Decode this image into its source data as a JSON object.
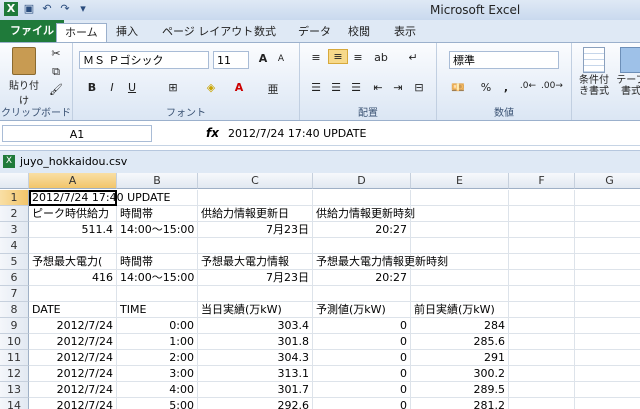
{
  "window": {
    "title": "Microsoft Excel"
  },
  "ribbon_tabs": [
    "ファイル",
    "ホーム",
    "挿入",
    "ページ レイアウト",
    "数式",
    "データ",
    "校閲",
    "表示"
  ],
  "ribbon": {
    "paste_label": "貼り付け",
    "clipboard_label": "クリップボード",
    "font_name": "ＭＳ Ｐゴシック",
    "font_size": "11",
    "font_group_label": "フォント",
    "align_group_label": "配置",
    "number_format": "標準",
    "number_group_label": "数値",
    "cond_format_label": "条件付き書式",
    "table_label": "テーブ書式"
  },
  "formula_bar": {
    "name_box": "A1",
    "fx": "fx",
    "formula": "2012/7/24 17:40 UPDATE"
  },
  "workbook": {
    "name": "juyo_hokkaidou.csv"
  },
  "columns": [
    "A",
    "B",
    "C",
    "D",
    "E",
    "F",
    "G"
  ],
  "rows": [
    {
      "n": "1",
      "cells": [
        "2012/7/24 17:40 UPDATE",
        "",
        "",
        "",
        "",
        "",
        ""
      ]
    },
    {
      "n": "2",
      "cells": [
        "ピーク時供給力",
        "時間帯",
        "供給力情報更新日",
        "供給力情報更新時刻",
        "",
        "",
        ""
      ]
    },
    {
      "n": "3",
      "cells": [
        "511.4",
        "14:00～15:00",
        "7月23日",
        "20:27",
        "",
        "",
        ""
      ]
    },
    {
      "n": "4",
      "cells": [
        "",
        "",
        "",
        "",
        "",
        "",
        ""
      ]
    },
    {
      "n": "5",
      "cells": [
        "予想最大電力(",
        "時間帯",
        "予想最大電力情報",
        "予想最大電力情報更新時刻",
        "",
        "",
        ""
      ]
    },
    {
      "n": "6",
      "cells": [
        "416",
        "14:00～15:00",
        "7月23日",
        "20:27",
        "",
        "",
        ""
      ]
    },
    {
      "n": "7",
      "cells": [
        "",
        "",
        "",
        "",
        "",
        "",
        ""
      ]
    },
    {
      "n": "8",
      "cells": [
        "DATE",
        "TIME",
        "当日実績(万kW)",
        "予測値(万kW)",
        "前日実績(万kW)",
        "",
        ""
      ]
    },
    {
      "n": "9",
      "cells": [
        "2012/7/24",
        "0:00",
        "303.4",
        "0",
        "284",
        "",
        ""
      ]
    },
    {
      "n": "10",
      "cells": [
        "2012/7/24",
        "1:00",
        "301.8",
        "0",
        "285.6",
        "",
        ""
      ]
    },
    {
      "n": "11",
      "cells": [
        "2012/7/24",
        "2:00",
        "304.3",
        "0",
        "291",
        "",
        ""
      ]
    },
    {
      "n": "12",
      "cells": [
        "2012/7/24",
        "3:00",
        "313.1",
        "0",
        "300.2",
        "",
        ""
      ]
    },
    {
      "n": "13",
      "cells": [
        "2012/7/24",
        "4:00",
        "301.7",
        "0",
        "289.5",
        "",
        ""
      ]
    },
    {
      "n": "14",
      "cells": [
        "2012/7/24",
        "5:00",
        "292.6",
        "0",
        "281.2",
        "",
        ""
      ]
    }
  ]
}
